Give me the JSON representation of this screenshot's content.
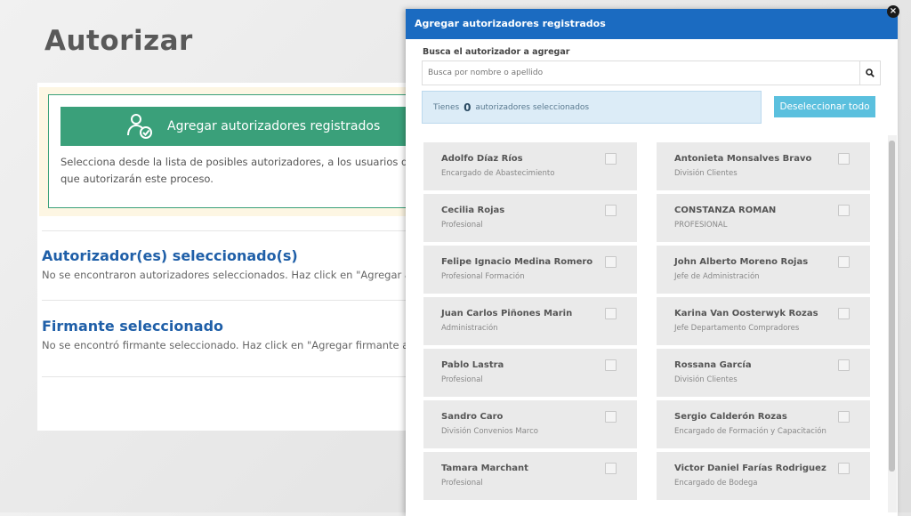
{
  "slide": {
    "title": "Autorizar"
  },
  "page": {
    "add_button_label": "Agregar autorizadores registrados",
    "notice_line1": "Selecciona desde la lista de posibles autorizadores, a los usuarios del sistem",
    "notice_line2": "que autorizarán este proceso.",
    "section1": {
      "title": "Autorizador(es) seleccionado(s)",
      "text": "No se encontraron autorizadores seleccionados. Haz click en \"Agregar autorizado"
    },
    "section2": {
      "title": "Firmante seleccionado",
      "text": "No se encontró firmante seleccionado. Haz click en \"Agregar firmante autorizado"
    }
  },
  "modal": {
    "title": "Agregar autorizadores registrados",
    "close_label": "×",
    "search_label": "Busca el autorizador a agregar",
    "search_placeholder": "Busca por nombre o apellido",
    "count_prefix": "Tienes",
    "count_value": "0",
    "count_suffix": "autorizadores seleccionados",
    "deselect_label": "Deseleccionar todo",
    "people": [
      {
        "name": "Adolfo Díaz Ríos",
        "role": "Encargado de Abastecimiento"
      },
      {
        "name": "Antonieta Monsalves Bravo",
        "role": "División Clientes"
      },
      {
        "name": "Cecilia Rojas",
        "role": "Profesional"
      },
      {
        "name": "CONSTANZA ROMAN",
        "role": "PROFESIONAL"
      },
      {
        "name": "Felipe Ignacio Medina Romero",
        "role": "Profesional Formación"
      },
      {
        "name": "John Alberto Moreno Rojas",
        "role": "Jefe de Administración"
      },
      {
        "name": "Juan Carlos Piñones Marin",
        "role": "Administración"
      },
      {
        "name": "Karina Van Oosterwyk Rozas",
        "role": "Jefe Departamento Compradores"
      },
      {
        "name": "Pablo Lastra",
        "role": "Profesional"
      },
      {
        "name": "Rossana García",
        "role": "División Clientes"
      },
      {
        "name": "Sandro Caro",
        "role": "División Convenios Marco"
      },
      {
        "name": "Sergio Calderón Rozas",
        "role": "Encargado de Formación y Capacitación"
      },
      {
        "name": "Tamara Marchant",
        "role": "Profesional"
      },
      {
        "name": "Victor Daniel Farías Rodriguez",
        "role": "Encargado de Bodega"
      }
    ]
  },
  "colors": {
    "header_blue": "#1b6bc1",
    "green": "#3aa07a",
    "button_cyan": "#5bc0de",
    "link_blue": "#1f5fa8"
  }
}
